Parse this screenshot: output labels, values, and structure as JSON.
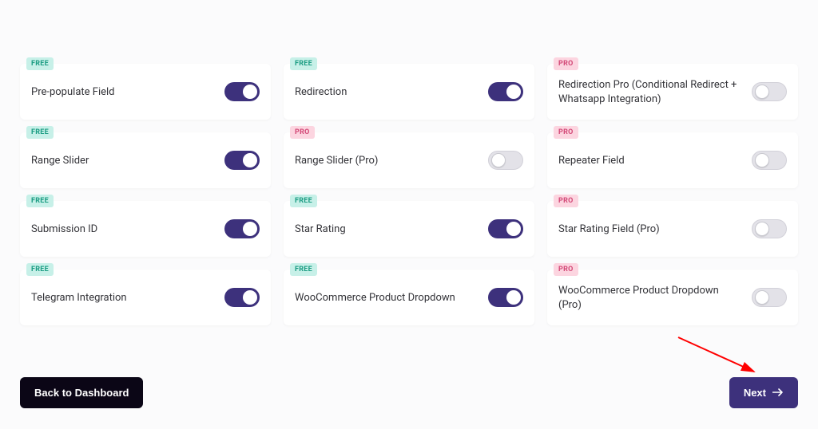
{
  "badges": {
    "free": "FREE",
    "pro": "PRO"
  },
  "items": [
    {
      "tier": "free",
      "label": "Pre-populate Field",
      "enabled": true
    },
    {
      "tier": "free",
      "label": "Redirection",
      "enabled": true
    },
    {
      "tier": "pro",
      "label": "Redirection Pro (Conditional Redirect + Whatsapp Integration)",
      "enabled": false
    },
    {
      "tier": "free",
      "label": "Range Slider",
      "enabled": true
    },
    {
      "tier": "pro",
      "label": "Range Slider (Pro)",
      "enabled": false
    },
    {
      "tier": "pro",
      "label": "Repeater Field",
      "enabled": false
    },
    {
      "tier": "free",
      "label": "Submission ID",
      "enabled": true
    },
    {
      "tier": "free",
      "label": "Star Rating",
      "enabled": true
    },
    {
      "tier": "pro",
      "label": "Star Rating Field (Pro)",
      "enabled": false
    },
    {
      "tier": "free",
      "label": "Telegram Integration",
      "enabled": true
    },
    {
      "tier": "free",
      "label": "WooCommerce Product Dropdown",
      "enabled": true
    },
    {
      "tier": "pro",
      "label": "WooCommerce Product Dropdown (Pro)",
      "enabled": false
    }
  ],
  "footer": {
    "back": "Back to Dashboard",
    "next": "Next"
  },
  "colors": {
    "accent": "#3d317c",
    "free_badge_bg": "#c7f0e8",
    "free_badge_fg": "#1a9c82",
    "pro_badge_bg": "#fcd5e0",
    "pro_badge_fg": "#d34a78"
  }
}
